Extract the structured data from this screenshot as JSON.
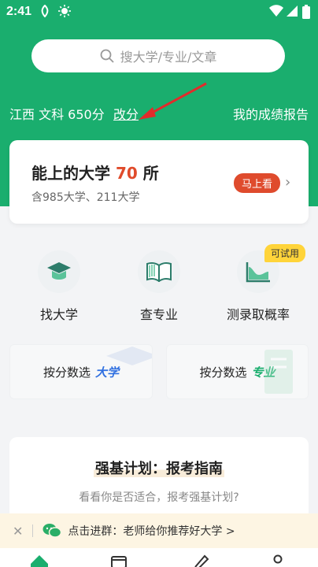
{
  "status": {
    "time": "2:41"
  },
  "search": {
    "placeholder": "搜大学/专业/文章"
  },
  "score": {
    "info": "江西 文科 650分",
    "change": "改分",
    "report": "我的成绩报告"
  },
  "card": {
    "title_prefix": "能上的大学",
    "count": "70",
    "title_suffix": "所",
    "subtitle": "含985大学、211大学",
    "badge": "马上看"
  },
  "tools": [
    {
      "label": "找大学",
      "icon": "graduation-cap-icon"
    },
    {
      "label": "查专业",
      "icon": "book-icon"
    },
    {
      "label": "测录取概率",
      "icon": "chart-icon"
    }
  ],
  "try_badge": "可试用",
  "filters": [
    {
      "prefix": "按分数选",
      "accent": "大学",
      "color": "#2f6fe0"
    },
    {
      "prefix": "按分数选",
      "accent": "专业",
      "color": "#1aae6e"
    }
  ],
  "guide": {
    "title": "强基计划：报考指南",
    "subtitle": "看看你是否适合，报考强基计划?"
  },
  "banner": {
    "text": "点击进群：老师给你推荐好大学 >"
  },
  "colors": {
    "primary": "#1aae6e",
    "accent": "#e04b2b",
    "badge": "#df4b2d",
    "try": "#ffd43a"
  }
}
